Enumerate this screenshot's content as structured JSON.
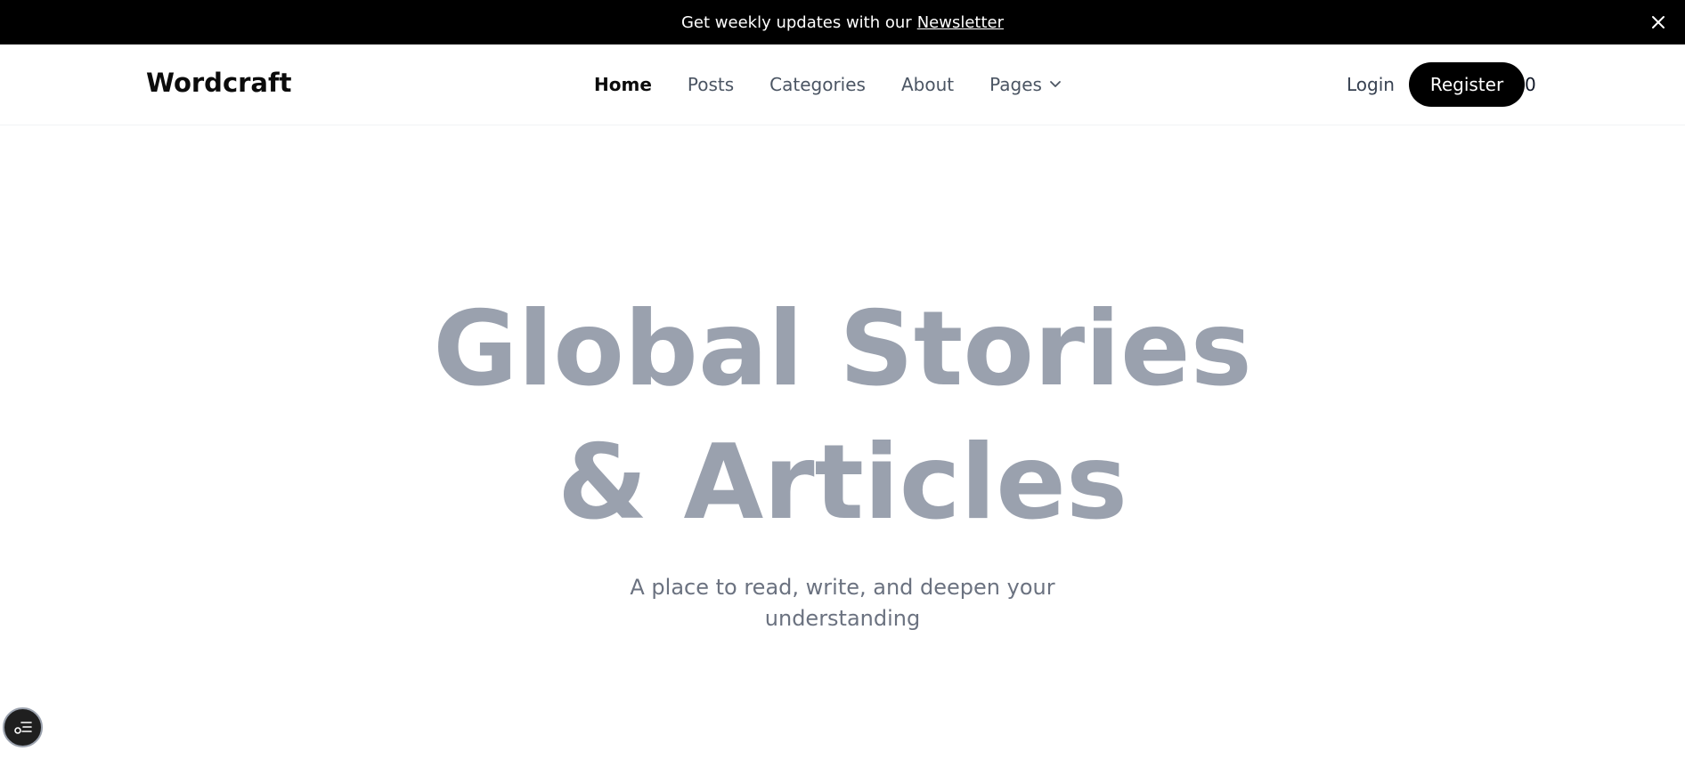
{
  "banner": {
    "text": "Get weekly updates with our",
    "link_label": "Newsletter",
    "close_icon": "close-icon"
  },
  "nav": {
    "logo": "Wordcraft",
    "links": [
      {
        "label": "Home",
        "active": true
      },
      {
        "label": "Posts",
        "active": false
      },
      {
        "label": "Categories",
        "active": false
      },
      {
        "label": "About",
        "active": false
      }
    ],
    "pages_label": "Pages",
    "pages_icon": "chevron-down-icon",
    "login_label": "Login",
    "register_label": "Register",
    "count": "0"
  },
  "hero": {
    "title_line1": "Global Stories",
    "title_line2": "& Articles",
    "subtitle_line1": "A place to read, write, and deepen your",
    "subtitle_line2": "understanding"
  },
  "fab": {
    "icon": "settings-list-icon"
  },
  "colors": {
    "banner_bg": "#000000",
    "hero_title": "#9aa1ae",
    "hero_subtitle": "#6b7280",
    "register_bg": "#000000"
  }
}
